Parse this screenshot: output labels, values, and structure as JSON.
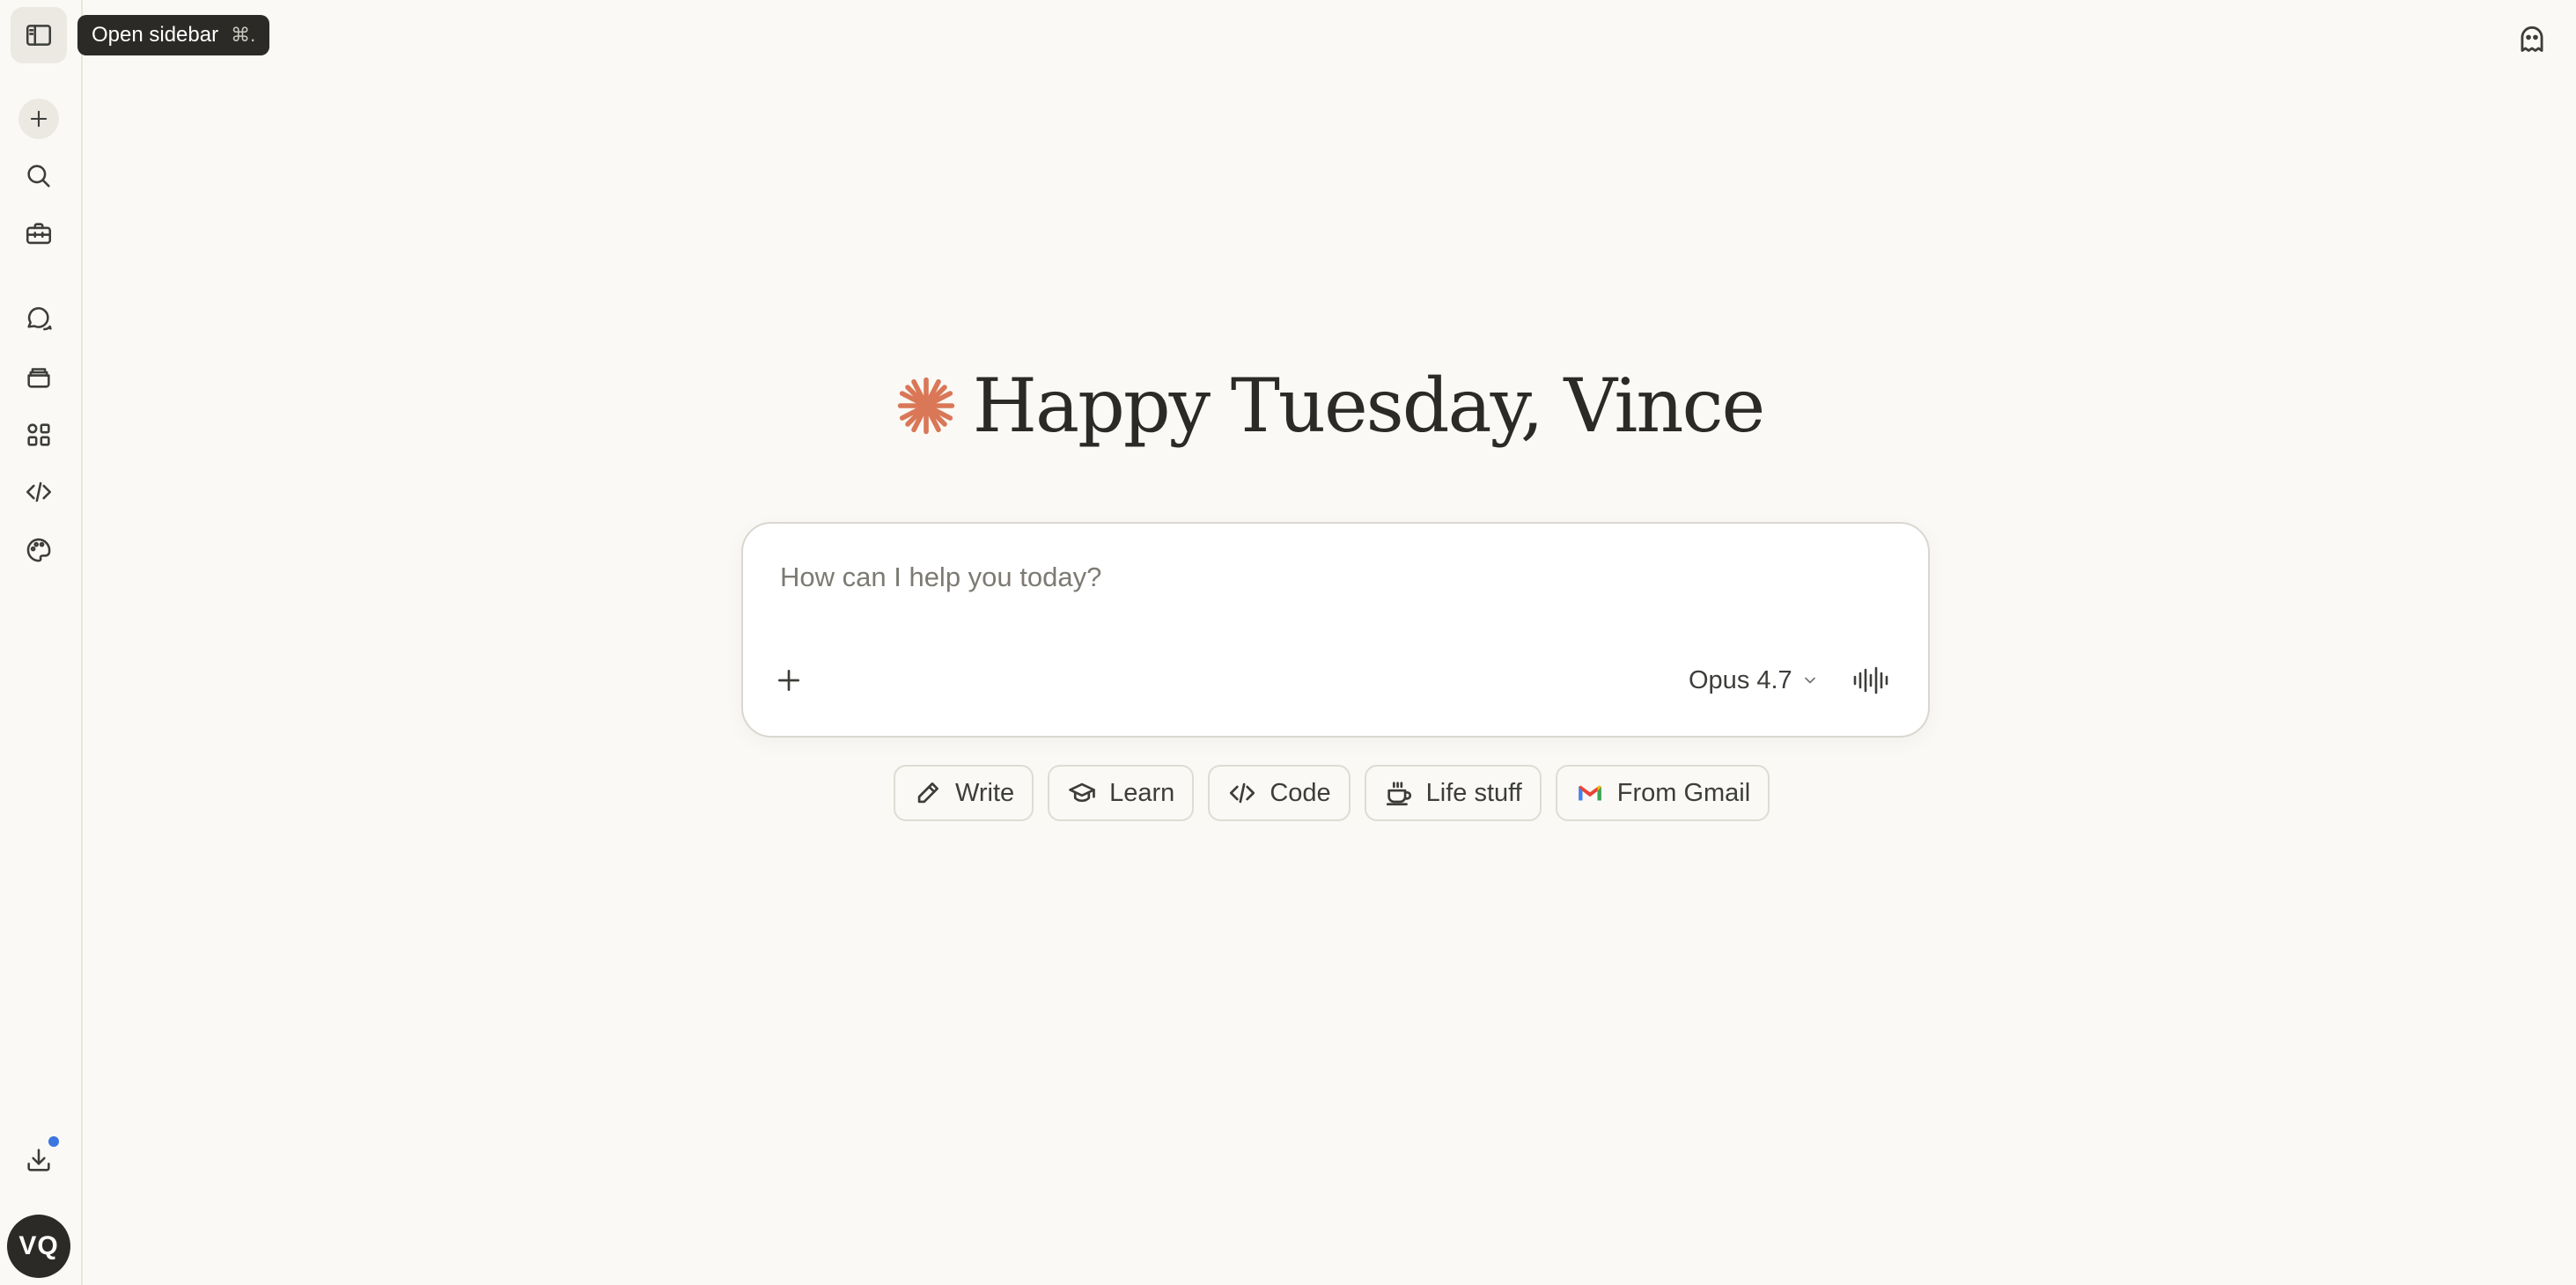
{
  "sidebar": {
    "tooltip": {
      "label": "Open sidebar",
      "shortcut": "⌘."
    },
    "icons": [
      "sidebar-toggle-icon",
      "new-chat-icon",
      "search-icon",
      "briefcase-icon",
      "chats-icon",
      "projects-icon",
      "artifacts-icon",
      "code-icon",
      "palette-icon",
      "download-icon"
    ],
    "avatar_initials": "VQ",
    "badge_color": "#3b76e1"
  },
  "header": {
    "top_right_icon": "ghost-icon"
  },
  "greeting": {
    "text": "Happy Tuesday, Vince",
    "accent_color": "#d97757"
  },
  "composer": {
    "placeholder": "How can I help you today?",
    "value": "",
    "model": "Opus 4.7"
  },
  "chips": [
    {
      "label": "Write",
      "icon": "pencil-icon"
    },
    {
      "label": "Learn",
      "icon": "graduation-cap-icon"
    },
    {
      "label": "Code",
      "icon": "code-icon"
    },
    {
      "label": "Life stuff",
      "icon": "coffee-icon"
    },
    {
      "label": "From Gmail",
      "icon": "gmail-icon"
    }
  ]
}
